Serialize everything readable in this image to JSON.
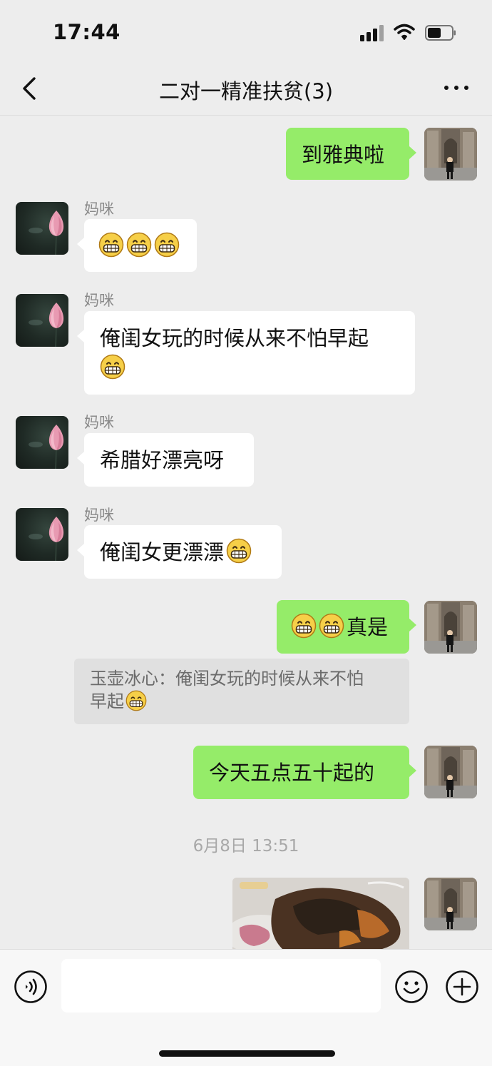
{
  "status_bar": {
    "time": "17:44"
  },
  "header": {
    "title": "二对一精准扶贫(3)"
  },
  "messages": [
    {
      "from": "me",
      "text": "到雅典啦"
    },
    {
      "from": "mom",
      "sender": "妈咪",
      "text": "",
      "emoji_count": 3
    },
    {
      "from": "mom",
      "sender": "妈咪",
      "text": "俺闺女玩的时候从来不怕早起"
    },
    {
      "from": "mom",
      "sender": "妈咪",
      "text": "希腊好漂亮呀"
    },
    {
      "from": "mom",
      "sender": "妈咪",
      "text": "俺闺女更漂漂"
    },
    {
      "from": "me",
      "text": "真是"
    },
    {
      "from": "me",
      "text": "今天五点五十起的"
    }
  ],
  "quote": {
    "line1": "玉壶冰心：俺闺女玩的时候从来不怕",
    "line2": "早起"
  },
  "timestamp": "6月8日 13:51",
  "icons": {
    "back": "chevron-left-icon",
    "more": "more-dots-icon",
    "voice": "voice-icon",
    "emoji": "smiley-icon",
    "add": "plus-icon",
    "grin": "grinning-face-icon"
  },
  "colors": {
    "outgoing_bubble": "#95ec69",
    "incoming_bubble": "#ffffff",
    "background": "#ededed"
  }
}
